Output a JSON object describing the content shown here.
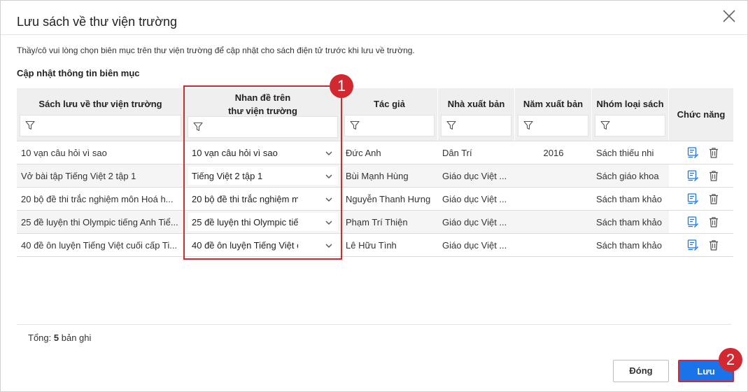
{
  "dialog": {
    "title": "Lưu sách về thư viện trường",
    "description": "Thầy/cô vui lòng chọn biên mục trên thư viện trường để cập nhật cho sách điện tử trước khi lưu về trường.",
    "section_title": "Cập nhật thông tin biên mục"
  },
  "table": {
    "headers": {
      "book": "Sách lưu về thư viện trường",
      "title_line1": "Nhan đề trên",
      "title_line2": "thư viện trường",
      "author": "Tác giả",
      "publisher": "Nhà xuất bản",
      "year": "Năm xuất bản",
      "category": "Nhóm loại sách",
      "actions": "Chức năng"
    },
    "rows": [
      {
        "book": "10 vạn câu hỏi vì sao",
        "title": "10 vạn câu hỏi vì sao",
        "author": "Đức Anh",
        "publisher": "Dân Trí",
        "year": "2016",
        "category": "Sách thiếu nhi"
      },
      {
        "book": "Vở bài tập Tiếng Việt 2 tập 1",
        "title": "Tiếng Việt 2 tập 1",
        "author": "Bùi Mạnh Hùng",
        "publisher": "Giáo dục Việt ...",
        "year": "",
        "category": "Sách giáo khoa"
      },
      {
        "book": "20 bộ đề thi trắc nghiệm môn Hoá h...",
        "title": "20 bộ đề thi trắc nghiệm m",
        "author": "Nguyễn Thanh Hưng",
        "publisher": "Giáo dục Việt ...",
        "year": "",
        "category": "Sách tham khảo"
      },
      {
        "book": "25 đề luyện thi Olympic tiếng Anh Tiể...",
        "title": "25 đề luyện thi Olympic tiế",
        "author": "Phạm Trí Thiện",
        "publisher": "Giáo dục Việt ...",
        "year": "",
        "category": "Sách tham khảo"
      },
      {
        "book": "40 đề ôn luyện Tiếng Việt cuối cấp Ti...",
        "title": "40 đề ôn luyện Tiếng Việt c",
        "author": "Lê Hữu Tình",
        "publisher": "Giáo dục Việt ...",
        "year": "",
        "category": "Sách tham khảo"
      }
    ]
  },
  "footer": {
    "total_label": "Tổng:",
    "total_count": "5",
    "total_unit": "bản ghi",
    "close_label": "Đóng",
    "save_label": "Lưu"
  },
  "annotations": {
    "badge1": "1",
    "badge2": "2"
  },
  "colors": {
    "accent": "#1a73e8",
    "highlight": "#d22830",
    "header_bg": "#efefef"
  }
}
